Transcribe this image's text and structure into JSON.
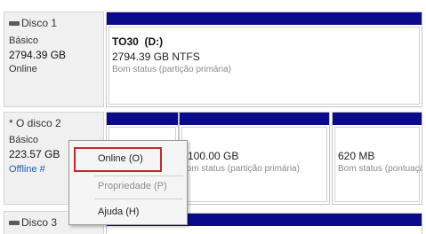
{
  "disks": [
    {
      "name": "Disco 1",
      "type": "Básico",
      "capacity": "2794.39 GB",
      "status": "Online",
      "partitions": [
        {
          "volume": "TO30  (D:)",
          "size": "2794.39 GB NTFS",
          "status": "Bom status (partição primária)"
        }
      ]
    },
    {
      "name": "* O disco 2",
      "type": "Básico",
      "capacity": "223.57 GB",
      "status": "Offline #",
      "partitions": [
        {
          "volume": "",
          "size": "",
          "status": ""
        },
        {
          "volume": "",
          "size": "100.00 GB",
          "status": "Bom status (partição primária)"
        },
        {
          "volume": "",
          "size": "620 MB",
          "status": "Bom status (pontuação"
        }
      ]
    },
    {
      "name": "Disco 3"
    }
  ],
  "context_menu": {
    "items": [
      {
        "label": "Online (O)",
        "enabled": true,
        "highlighted": true
      },
      {
        "label": "Propriedade (P)",
        "enabled": false
      },
      {
        "label": "Ajuda (H)",
        "enabled": true
      }
    ]
  },
  "colors": {
    "partition_header": "#0a0a8c",
    "highlight_border": "#c62828",
    "link": "#1c5fb8"
  }
}
